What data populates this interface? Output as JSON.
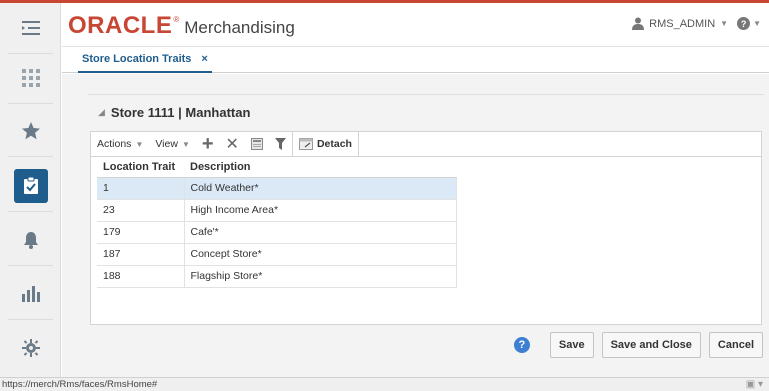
{
  "brand": {
    "oracle": "ORACLE",
    "reg": "®",
    "app": "Merchandising"
  },
  "user": {
    "name": "RMS_ADMIN",
    "caret": "▼",
    "help_icon": "?",
    "help_caret": "▼"
  },
  "tab": {
    "label": "Store Location Traits",
    "close": "×"
  },
  "panel": {
    "disclose": "◢",
    "title": "Store 1111 | Manhattan"
  },
  "toolbar": {
    "actions": "Actions",
    "view": "View",
    "caret": "▼",
    "add": "+",
    "delete": "✕",
    "detach": "Detach"
  },
  "table": {
    "columns": [
      "Location Trait",
      "Description"
    ],
    "rows": [
      {
        "trait": "1",
        "desc": "Cold Weather*"
      },
      {
        "trait": "23",
        "desc": "High Income Area*"
      },
      {
        "trait": "179",
        "desc": "Cafe'*"
      },
      {
        "trait": "187",
        "desc": "Concept Store*"
      },
      {
        "trait": "188",
        "desc": "Flagship Store*"
      }
    ]
  },
  "buttons": {
    "help": "?",
    "save": "Save",
    "save_close": "Save and Close",
    "cancel": "Cancel"
  },
  "status": {
    "url": "https://merch/Rms/faces/RmsHome#",
    "icon": "▣ ▾"
  },
  "colors": {
    "accent": "#1f5d8c",
    "oracle_red": "#c74634",
    "selected_row": "#dbe9f6"
  }
}
